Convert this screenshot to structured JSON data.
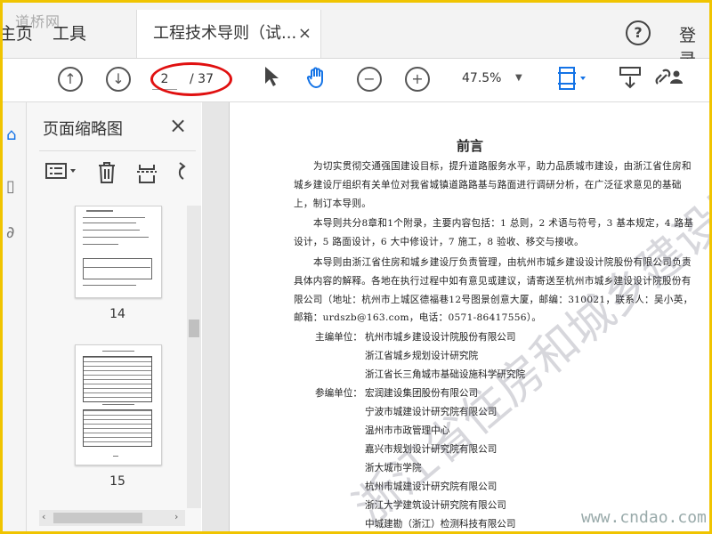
{
  "tabs": {
    "home_label": "主页",
    "tools_label": "工具",
    "document_label": "工程技术导则（试...",
    "close_glyph": "×"
  },
  "header": {
    "help_glyph": "?",
    "login_label": "登录"
  },
  "watermark_top": "道桥网",
  "toolbar": {
    "current_page": "2",
    "total_pages": "/ 37",
    "zoom": "47.5%"
  },
  "thumbnail_panel": {
    "title": "页面缩略图",
    "thumbnails": [
      {
        "page_label": "14"
      },
      {
        "page_label": "15"
      }
    ]
  },
  "document": {
    "heading": "前言",
    "para1": "为切实贯彻交通强国建设目标，提升道路服务水平，助力品质城市建设，由浙江省住房和城乡建设厅组织有关单位对我省城镇道路路基与路面进行调研分析，在广泛征求意见的基础上，制订本导则。",
    "para2": "本导则共分8章和1个附录，主要内容包括：1 总则，2 术语与符号，3 基本规定，4 路基设计，5 路面设计，6 大中修设计，7 施工，8 验收、移交与接收。",
    "para3": "本导则由浙江省住房和城乡建设厅负责管理，由杭州市城乡建设设计院股份有限公司负责具体内容的解释。各地在执行过程中如有意见或建议，请寄送至杭州市城乡建设设计院股份有限公司（地址：杭州市上城区德福巷12号图景创意大厦，邮编：310021，联系人：吴小英，邮箱：urdszb@163.com，电话：0571-86417556）。",
    "chief_label": "主编单位：",
    "chief_units": [
      "杭州市城乡建设设计院股份有限公司",
      "浙江省城乡规划设计研究院",
      "浙江省长三角城市基础设施科学研究院"
    ],
    "participant_label": "参编单位：",
    "participant_units": [
      "宏润建设集团股份有限公司",
      "宁波市城建设计研究院有限公司",
      "温州市市政管理中心",
      "嘉兴市规划设计研究院有限公司",
      "浙大城市学院",
      "杭州市城建设计研究院有限公司",
      "浙江大学建筑设计研究院有限公司",
      "中城建勘（浙江）检测科技有限公司"
    ],
    "background_watermark": "浙江省住房和城乡建设厅"
  },
  "site_watermark": "www.cndao.com",
  "colors": {
    "accent": "#1473e6",
    "annotation": "#e01010",
    "border": "#f0c400"
  }
}
